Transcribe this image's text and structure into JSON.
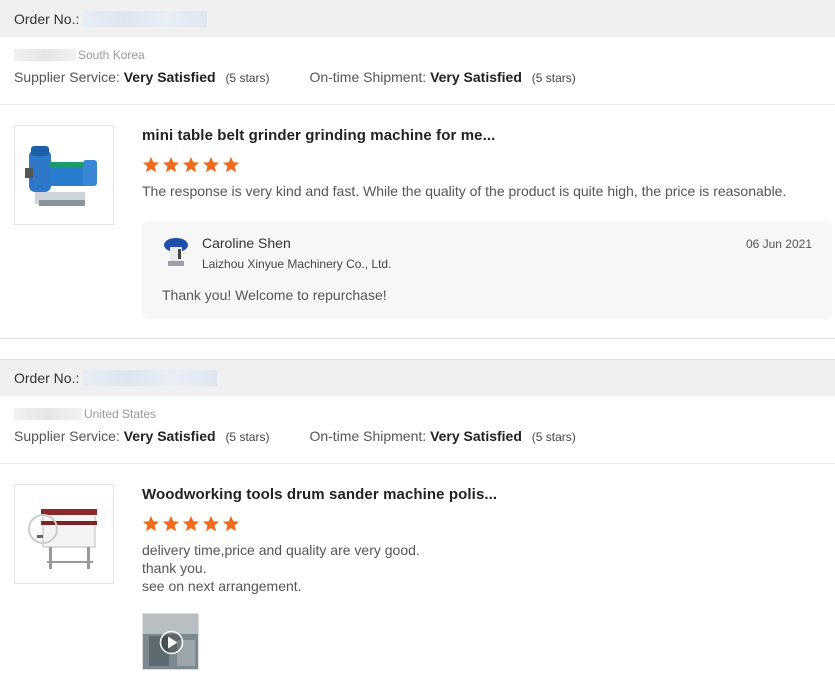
{
  "reviews": [
    {
      "order_label": "Order No.:",
      "buyer_location": "South Korea",
      "supplier_service_label": "Supplier Service:",
      "supplier_service_value": "Very Satisfied",
      "supplier_service_stars": "(5 stars)",
      "shipment_label": "On-time Shipment:",
      "shipment_value": "Very Satisfied",
      "shipment_stars": "(5 stars)",
      "product_title": "mini table belt grinder grinding machine for me...",
      "rating": 5,
      "comment": "The response is very kind and fast. While the quality of the product is quite high, the price is reasonable.",
      "reply": {
        "name": "Caroline Shen",
        "company": "Laizhou Xinyue Machinery Co., Ltd.",
        "date": "06 Jun 2021",
        "message": "Thank you! Welcome to repurchase!"
      }
    },
    {
      "order_label": "Order No.:",
      "buyer_location": "United States",
      "supplier_service_label": "Supplier Service:",
      "supplier_service_value": "Very Satisfied",
      "supplier_service_stars": "(5 stars)",
      "shipment_label": "On-time Shipment:",
      "shipment_value": "Very Satisfied",
      "shipment_stars": "(5 stars)",
      "product_title": "Woodworking tools drum sander machine polis...",
      "rating": 5,
      "comment_lines": [
        "delivery time,price and quality are very good.",
        "thank you.",
        "see on next arrangement."
      ]
    }
  ],
  "colors": {
    "star": "#f26b1d",
    "order_bar": "#f0f0f0",
    "reply_bg": "#f7f7f7"
  },
  "icons": {
    "star": "star-icon",
    "play": "play-icon"
  }
}
